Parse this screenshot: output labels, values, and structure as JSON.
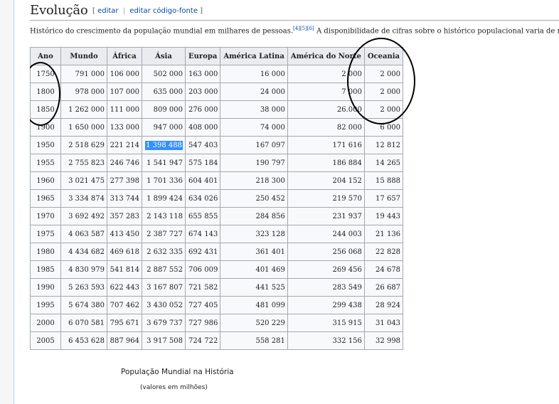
{
  "section": {
    "title": "Evolução",
    "edit_open": "[",
    "edit_label": "editar",
    "edit_sep": "|",
    "edit_source_label": "editar código-fonte",
    "edit_close": "]"
  },
  "intro": {
    "text_before": "Histórico do crescimento da população mundial em milhares de pessoas.",
    "refs": "[4][5][6]",
    "text_after": " A disponibilidade de cifras sobre o histórico populacional varia de região"
  },
  "table": {
    "headers": [
      "Ano",
      "Mundo",
      "África",
      "Ásia",
      "Europa",
      "América Latina",
      "América do Norte",
      "Oceania"
    ],
    "rows": [
      [
        "1750",
        "791 000",
        "106 000",
        "502 000",
        "163 000",
        "16 000",
        "2 000",
        "2 000"
      ],
      [
        "1800",
        "978 000",
        "107 000",
        "635 000",
        "203 000",
        "24 000",
        "7 000",
        "2 000"
      ],
      [
        "1850",
        "1 262 000",
        "111 000",
        "809 000",
        "276 000",
        "38 000",
        "26.000",
        "2 000"
      ],
      [
        "1900",
        "1 650 000",
        "133 000",
        "947 000",
        "408 000",
        "74 000",
        "82 000",
        "6 000"
      ],
      [
        "1950",
        "2 518 629",
        "221 214",
        "1 398 488",
        "547 403",
        "167 097",
        "171 616",
        "12 812"
      ],
      [
        "1955",
        "2 755 823",
        "246 746",
        "1 541 947",
        "575 184",
        "190 797",
        "186 884",
        "14 265"
      ],
      [
        "1960",
        "3 021 475",
        "277 398",
        "1 701 336",
        "604 401",
        "218 300",
        "204 152",
        "15 888"
      ],
      [
        "1965",
        "3 334 874",
        "313 744",
        "1 899 424",
        "634 026",
        "250 452",
        "219 570",
        "17 657"
      ],
      [
        "1970",
        "3 692 492",
        "357 283",
        "2 143 118",
        "655 855",
        "284 856",
        "231 937",
        "19 443"
      ],
      [
        "1975",
        "4 063 587",
        "413 450",
        "2 387 727",
        "674 143",
        "323 128",
        "244 003",
        "21 136"
      ],
      [
        "1980",
        "4 434 682",
        "469 618",
        "2 632 335",
        "692 431",
        "361 401",
        "256 068",
        "22 828"
      ],
      [
        "1985",
        "4 830 979",
        "541 814",
        "2 887 552",
        "706 009",
        "401 469",
        "269 456",
        "24 678"
      ],
      [
        "1990",
        "5 263 593",
        "622 443",
        "3 167 807",
        "721 582",
        "441 525",
        "283 549",
        "26 687"
      ],
      [
        "1995",
        "5 674 380",
        "707 462",
        "3 430 052",
        "727 405",
        "481 099",
        "299 438",
        "28 924"
      ],
      [
        "2000",
        "6 070 581",
        "795 671",
        "3 679 737",
        "727 986",
        "520 229",
        "315 915",
        "31 043"
      ],
      [
        "2005",
        "6 453 628",
        "887 964",
        "3 917 508",
        "724 722",
        "558 281",
        "332 156",
        "32 998"
      ]
    ],
    "selected_cell": "1 398 488"
  },
  "chart_caption": {
    "title": "População Mundial na História",
    "subtitle": "(valores em milhões)"
  }
}
